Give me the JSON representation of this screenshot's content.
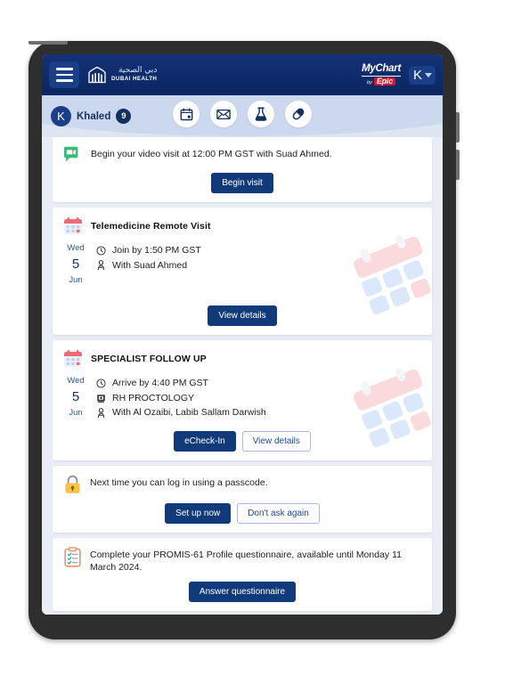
{
  "device": {
    "type": "tablet"
  },
  "header": {
    "menu_label": "Menu",
    "brand_ar": "دبي الصحية",
    "brand_en": "DUBAI HEALTH",
    "mychart_top": "MyChart",
    "mychart_by": "by",
    "mychart_epic": "Epic",
    "account_initial": "K"
  },
  "patient_bar": {
    "avatar_initial": "K",
    "name": "Khaled",
    "badge_count": "9",
    "quick_nav": [
      {
        "name": "calendar-icon",
        "label": "Appointments"
      },
      {
        "name": "envelope-icon",
        "label": "Messages"
      },
      {
        "name": "flask-icon",
        "label": "Test Results"
      },
      {
        "name": "pill-icon",
        "label": "Medications"
      }
    ]
  },
  "feed": {
    "video_visit": {
      "icon": "video-chat-icon",
      "message": "Begin your video visit at 12:00 PM GST with Suad Ahmed.",
      "button": "Begin visit"
    },
    "appointments": [
      {
        "title": "Telemedicine Remote Visit",
        "dow": "Wed",
        "day": "5",
        "month": "Jun",
        "lines": [
          {
            "icon": "clock-icon",
            "text": "Join by 1:50 PM GST"
          },
          {
            "icon": "person-icon",
            "text": "With Suad Ahmed"
          }
        ],
        "buttons": [
          {
            "label": "View details",
            "style": "primary"
          }
        ]
      },
      {
        "title": "SPECIALIST FOLLOW UP",
        "dow": "Wed",
        "day": "5",
        "month": "Jun",
        "lines": [
          {
            "icon": "clock-icon",
            "text": "Arrive by 4:40 PM GST"
          },
          {
            "icon": "hospital-icon",
            "text": "RH PROCTOLOGY"
          },
          {
            "icon": "person-icon",
            "text": "With Al Ozaibi, Labib Sallam Darwish"
          }
        ],
        "buttons": [
          {
            "label": "eCheck-In",
            "style": "primary"
          },
          {
            "label": "View details",
            "style": "secondary"
          }
        ]
      }
    ],
    "passcode": {
      "icon": "lock-icon",
      "message": "Next time you can log in using a passcode.",
      "buttons": [
        {
          "label": "Set up now",
          "style": "primary"
        },
        {
          "label": "Don't ask again",
          "style": "secondary"
        }
      ]
    },
    "questionnaire": {
      "icon": "clipboard-icon",
      "message": "Complete your PROMIS-61 Profile questionnaire, available until Monday 11 March 2024.",
      "button": "Answer questionnaire"
    }
  },
  "colors": {
    "brand_navy": "#0d2c6b",
    "button_navy": "#113a7a",
    "epic_red": "#d7152b",
    "patient_bar": "#dfe6f3",
    "feed_bg": "#e9edf5",
    "link_blue": "#1b4b9c"
  }
}
